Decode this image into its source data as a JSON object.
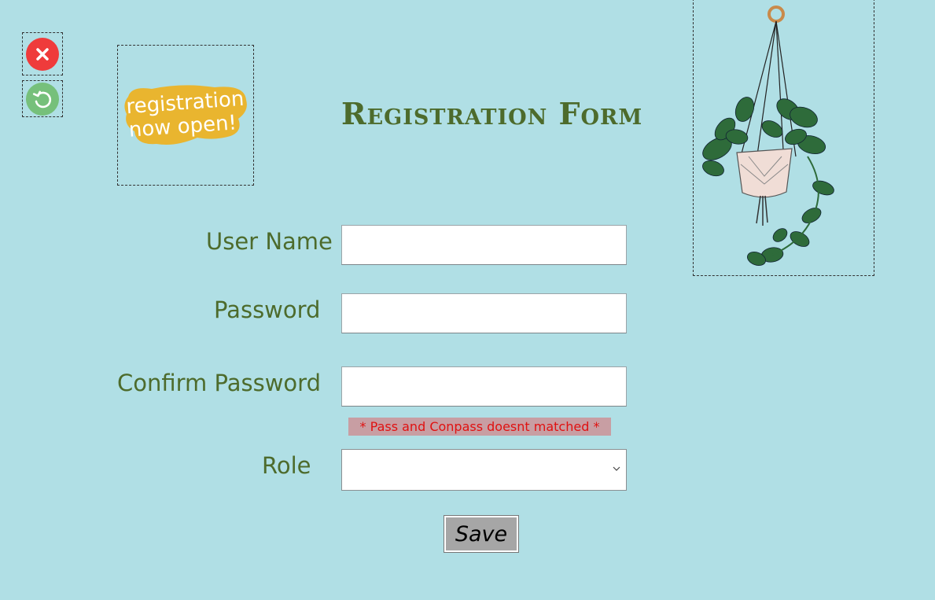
{
  "header": {
    "title": "Registration Form",
    "logo_text_line1": "registration",
    "logo_text_line2": "now open!"
  },
  "toolbar": {
    "close_icon": "close-icon",
    "reset_icon": "undo-icon"
  },
  "form": {
    "username_label": "User Name",
    "username_value": "",
    "password_label": "Password",
    "password_value": "",
    "confirm_label": "Confirm Password",
    "confirm_value": "",
    "error_message": "* Pass and Conpass doesnt matched *",
    "role_label": "Role",
    "role_value": "",
    "save_label": "Save"
  },
  "colors": {
    "background": "#b0dfe5",
    "label": "#4d6b2c",
    "error_text": "#e01111",
    "error_bg": "#c89ea3",
    "close_red": "#ef3b3b",
    "reset_green": "#76c07b",
    "logo_yellow": "#e9b52f"
  }
}
